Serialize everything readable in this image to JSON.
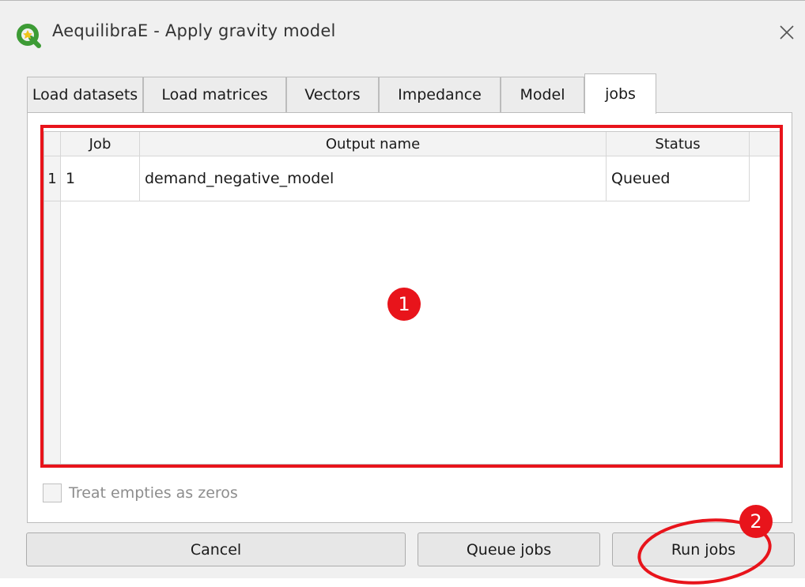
{
  "window": {
    "title": "AequilibraE - Apply gravity model",
    "close_symbol": "✕"
  },
  "tabs": [
    {
      "label": "Load datasets"
    },
    {
      "label": "Load matrices"
    },
    {
      "label": "Vectors"
    },
    {
      "label": "Impedance"
    },
    {
      "label": "Model"
    },
    {
      "label": "jobs",
      "active": true
    }
  ],
  "jobs_table": {
    "columns": [
      "Job",
      "Output name",
      "Status"
    ],
    "rows": [
      {
        "row_number": "1",
        "job": "1",
        "output_name": "demand_negative_model",
        "status": "Queued"
      }
    ]
  },
  "options": {
    "treat_empties_label": "Treat empties as zeros",
    "treat_empties_checked": false,
    "treat_empties_enabled": false
  },
  "buttons": {
    "cancel": "Cancel",
    "queue_jobs": "Queue jobs",
    "run_jobs": "Run jobs"
  },
  "annotations": {
    "marker_1": "1",
    "marker_2": "2",
    "highlight_color": "#e8141b"
  },
  "icons": {
    "app_logo": "qgis-logo-icon",
    "close": "close-icon"
  },
  "colors": {
    "window_bg": "#f0f0f0",
    "qgis_green": "#3d9b35",
    "qgis_yellow": "#f0c419"
  }
}
